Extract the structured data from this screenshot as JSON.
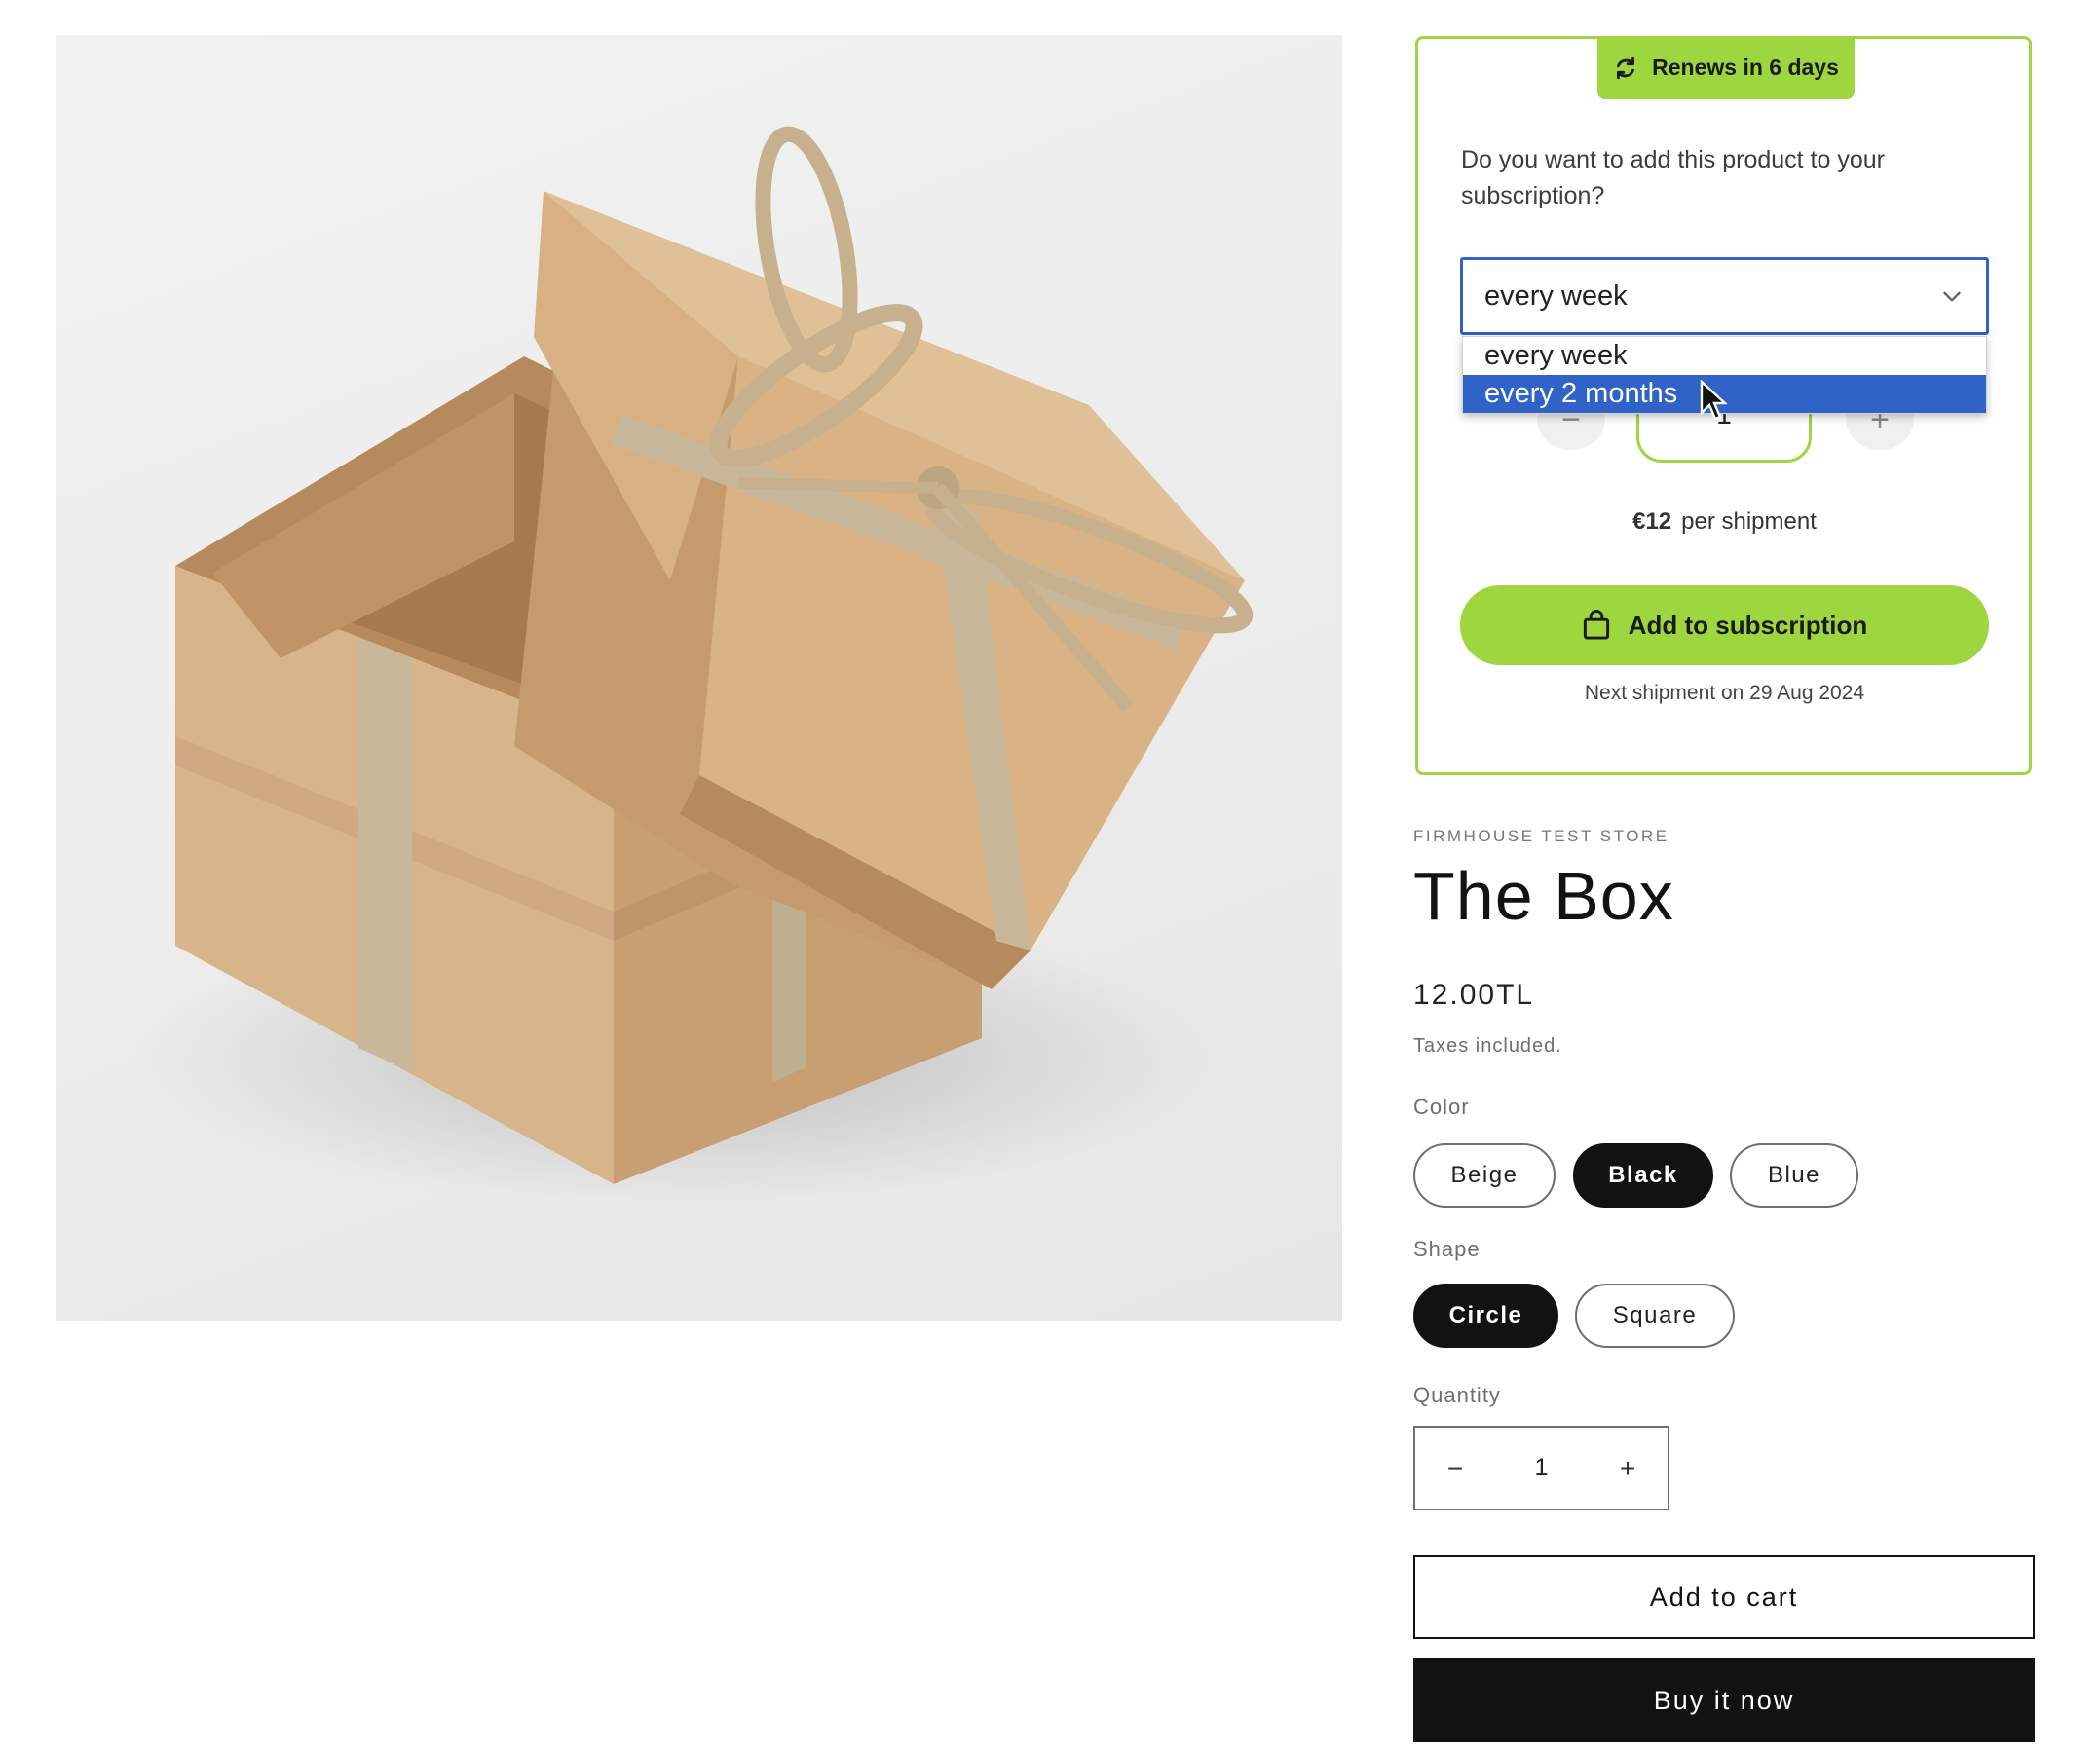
{
  "product_image": {
    "alt": "Kraft gift box with open lid and ribbon bow",
    "colors": {
      "box": "#d8b48a",
      "box_shadow": "#b88f63",
      "ribbon": "#c9b79a"
    }
  },
  "subscription": {
    "badge": "Renews in 6 days",
    "question": "Do you want to add this product to your subscription?",
    "frequency_selected": "every week",
    "frequency_options": [
      "every week",
      "every 2 months"
    ],
    "highlighted_option": "every 2 months",
    "stepper": {
      "minus": "−",
      "value": "1",
      "plus": "+"
    },
    "price": "€12",
    "price_suffix": "per shipment",
    "add_button": "Add to subscription",
    "next_shipment": "Next shipment on 29 Aug 2024",
    "accent_color": "#9dd63f"
  },
  "product": {
    "vendor": "FIRMHOUSE TEST STORE",
    "title": "The Box",
    "price": "12.00TL",
    "tax_note": "Taxes included.",
    "color_label": "Color",
    "colors": [
      "Beige",
      "Black",
      "Blue"
    ],
    "selected_color": "Black",
    "shape_label": "Shape",
    "shapes": [
      "Circle",
      "Square"
    ],
    "selected_shape": "Circle",
    "quantity_label": "Quantity",
    "quantity": {
      "minus": "−",
      "value": "1",
      "plus": "+"
    },
    "add_to_cart": "Add to cart",
    "buy_now": "Buy it now"
  }
}
